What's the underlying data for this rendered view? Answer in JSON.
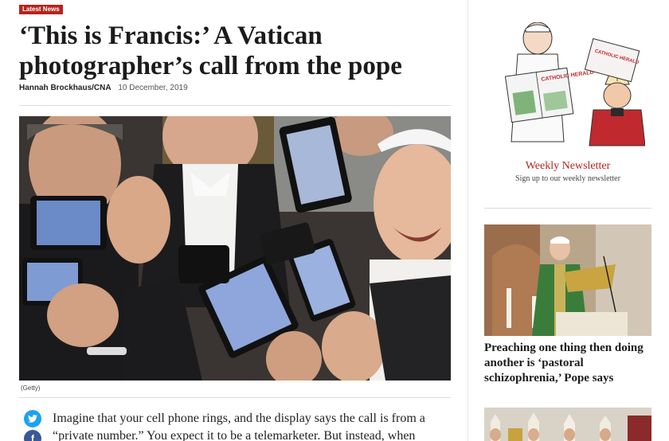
{
  "article": {
    "badge": "Latest News",
    "headline": "‘This is Francis:’ A Vatican photographer’s call from the pope",
    "author": "Hannah Brockhaus/CNA",
    "date": "10 December, 2019",
    "image_credit": "(Getty)",
    "body_intro": "Imagine that your cell phone rings, and the display says the call is from a “private number.” You expect it to be a telemarketer. But instead, when"
  },
  "share": {
    "twitter_icon": "twitter-icon",
    "facebook_icon": "facebook-icon"
  },
  "sidebar": {
    "cartoon_labels": [
      "CATHOLIC HERALD",
      "CATHOLIC HERALD"
    ],
    "newsletter_title": "Weekly Newsletter",
    "newsletter_subtitle": "Sign up to our weekly newsletter",
    "story_title": "Preaching one thing then doing another is ‘pastoral schizophrenia,’ Pope says"
  },
  "colors": {
    "accent": "#b8221d",
    "twitter": "#1da1f2",
    "facebook": "#3b5998"
  }
}
